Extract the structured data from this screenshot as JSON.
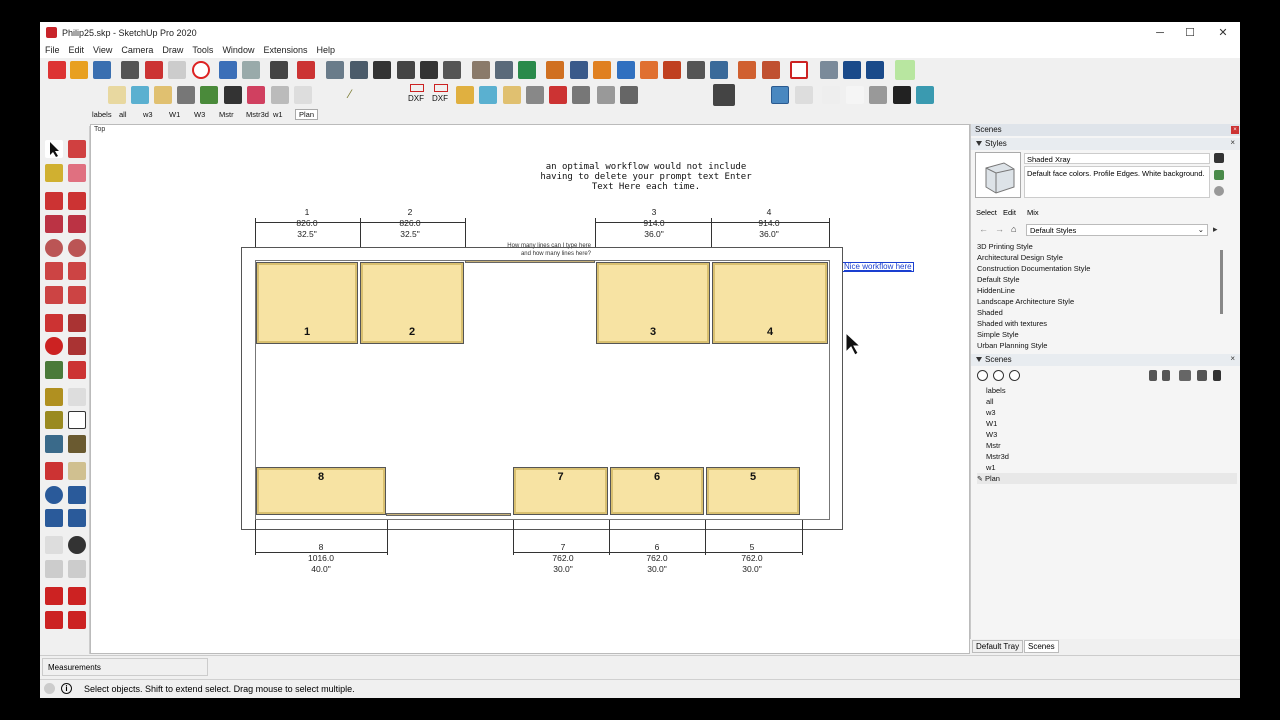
{
  "window": {
    "title": "Philip25.skp - SketchUp Pro 2020",
    "minimize": "─",
    "maximize": "☐",
    "close": "✕"
  },
  "menu": [
    "File",
    "Edit",
    "View",
    "Camera",
    "Draw",
    "Tools",
    "Window",
    "Extensions",
    "Help"
  ],
  "scene_tabs": [
    "labels",
    "all",
    "w3",
    "W1",
    "W3",
    "Mstr",
    "Mstr3d",
    "w1",
    "Plan"
  ],
  "toolbar2": {
    "pencil_glyph": "⁄",
    "dxf1": "DXF",
    "dxf2": "DXF"
  },
  "viewport": {
    "view_label": "Top",
    "note": "an optimal workflow would not include having to delete your prompt text Enter Text Here each time.",
    "small_note": "How many lines can I type here and how many lines here?",
    "link_text": "Nice workflow here",
    "upper_dims": [
      {
        "num": "1",
        "mm": "826.0",
        "in": "32.5\""
      },
      {
        "num": "2",
        "mm": "826.0",
        "in": "32.5\""
      },
      {
        "num": "3",
        "mm": "914.0",
        "in": "36.0\""
      },
      {
        "num": "4",
        "mm": "914.0",
        "in": "36.0\""
      }
    ],
    "lower_dims": [
      {
        "num": "8",
        "mm": "1016.0",
        "in": "40.0\""
      },
      {
        "num": "7",
        "mm": "762.0",
        "in": "30.0\""
      },
      {
        "num": "6",
        "mm": "762.0",
        "in": "30.0\""
      },
      {
        "num": "5",
        "mm": "762.0",
        "in": "30.0\""
      }
    ],
    "upper_cabinets": [
      "1",
      "2",
      "3",
      "4"
    ],
    "lower_cabinets": [
      "8",
      "7",
      "6",
      "5"
    ]
  },
  "tray": {
    "title": "Scenes",
    "styles": {
      "header": "Styles",
      "current_name": "Shaded Xray",
      "current_desc": "Default face colors. Profile Edges. White background.",
      "tabs": [
        "Select",
        "Edit",
        "Mix"
      ],
      "dropdown": "Default Styles",
      "list": [
        "3D Printing Style",
        "Architectural Design Style",
        "Construction Documentation Style",
        "Default Style",
        "HiddenLine",
        "Landscape Architecture Style",
        "Shaded",
        "Shaded with textures",
        "Simple Style",
        "Urban Planning Style"
      ]
    },
    "scenes": {
      "header": "Scenes",
      "list": [
        "labels",
        "all",
        "w3",
        "W1",
        "W3",
        "Mstr",
        "Mstr3d",
        "w1",
        "Plan"
      ],
      "selected_marker": "✎"
    },
    "bottom_tabs": [
      "Default Tray",
      "Scenes"
    ]
  },
  "measurements": {
    "label": "Measurements"
  },
  "status": {
    "text": "Select objects. Shift to extend select. Drag mouse to select multiple.",
    "info_icon": "i"
  },
  "colors": {
    "cabinet": "#f7e3a3",
    "accent_red": "#c8242a",
    "link": "#1a3fd0"
  }
}
